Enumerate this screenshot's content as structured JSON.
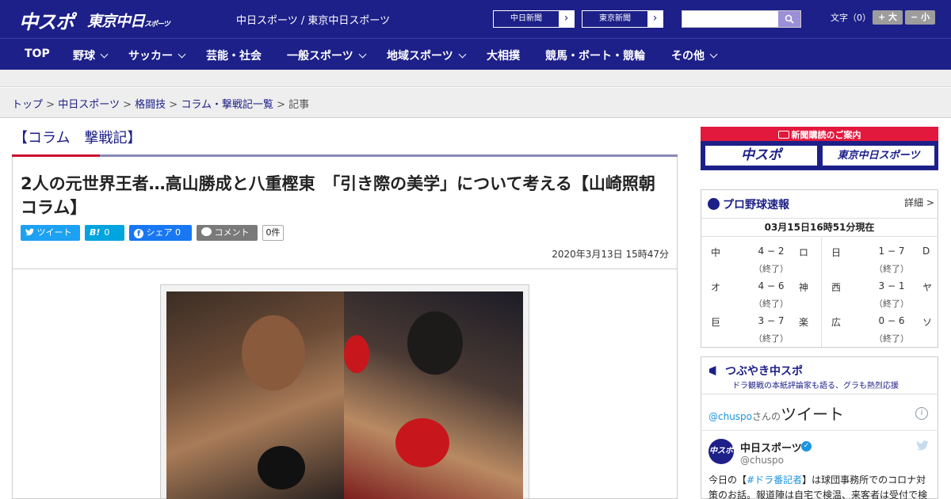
{
  "header": {
    "logo_main": "中スポ",
    "logo_tokyo": "東京中日",
    "logo_tokyo_suffix": "スポーツ",
    "site_links": "中日スポーツ / 東京中日スポーツ",
    "paper_buttons": [
      "中日新聞",
      "東京新聞"
    ],
    "search_placeholder": "",
    "font_size_label": "文字（0）",
    "font_larger": "+ 大",
    "font_smaller": "− 小"
  },
  "nav": {
    "items": [
      {
        "label": "TOP",
        "has_menu": false
      },
      {
        "label": "野球",
        "has_menu": true
      },
      {
        "label": "サッカー",
        "has_menu": true
      },
      {
        "label": "芸能・社会",
        "has_menu": false
      },
      {
        "label": "一般スポーツ",
        "has_menu": true
      },
      {
        "label": "地域スポーツ",
        "has_menu": true
      },
      {
        "label": "大相撲",
        "has_menu": false
      },
      {
        "label": "競馬・ボート・競輪",
        "has_menu": false
      },
      {
        "label": "その他",
        "has_menu": true
      }
    ]
  },
  "breadcrumb": {
    "items": [
      "トップ",
      "中日スポーツ",
      "格闘技",
      "コラム・撃戦記一覧"
    ],
    "current": "記事",
    "separator": ">"
  },
  "article": {
    "section_title": "【コラム　撃戦記】",
    "headline": "2人の元世界王者…高山勝成と八重樫東　「引き際の美学」について考える【山崎照朝コラム】",
    "share": {
      "tweet": "ツイート",
      "hatena_count": "0",
      "facebook": "シェア 0",
      "comment": "コメント",
      "comment_count": "0件"
    },
    "date": "2020年3月13日 15時47分"
  },
  "sidebar": {
    "subscription_title": "新聞購読のご案内",
    "subscription_logos": [
      "中スポ",
      "東京中日スポーツ"
    ],
    "scores": {
      "title": "プロ野球速報",
      "more": "詳細 >",
      "timestamp": "03月15日16時51分現在",
      "games": [
        {
          "home": "中",
          "score": "4 − 2",
          "away": "ロ",
          "status": "（終了）"
        },
        {
          "home": "日",
          "score": "1 − 7",
          "away": "D",
          "status": "（終了）"
        },
        {
          "home": "オ",
          "score": "4 − 6",
          "away": "神",
          "status": "（終了）"
        },
        {
          "home": "西",
          "score": "3 − 1",
          "away": "ヤ",
          "status": "（終了）"
        },
        {
          "home": "巨",
          "score": "3 − 7",
          "away": "楽",
          "status": "（終了）"
        },
        {
          "home": "広",
          "score": "0 − 6",
          "away": "ソ",
          "status": "（終了）"
        }
      ]
    },
    "twitter": {
      "title": "つぶやき中スポ",
      "subtitle": "ドラ観戦の本紙評論家も語る、グラも熱烈応援",
      "handle_link": "@chuspo",
      "handle_suffix": "さんの",
      "tweets_word": "ツイート",
      "tweet": {
        "name": "中日スポーツ",
        "handle": "@chuspo",
        "avatar_text": "中スポ",
        "text_before": "今日の【",
        "hashtag": "#ドラ番記者",
        "text_after": "】は球団事務所でのコロナ対策のお話。報道陣は自宅で検温、来客者は受付で検"
      }
    }
  }
}
